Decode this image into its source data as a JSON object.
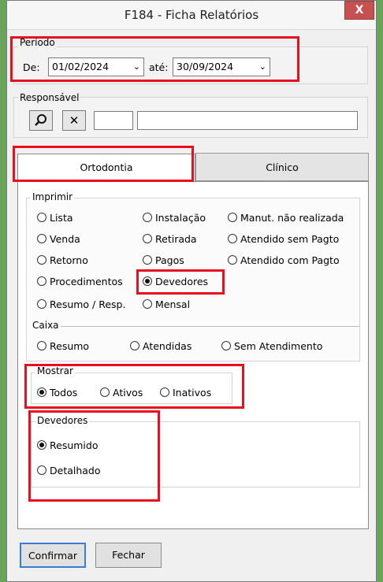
{
  "window": {
    "title": "F184 - Ficha Relatórios",
    "close_label": "X"
  },
  "periodo": {
    "label": "Período",
    "de_label": "De:",
    "de_value": "01/02/2024",
    "ate_label": "até:",
    "ate_value": "30/09/2024"
  },
  "responsavel": {
    "label": "Responsável",
    "search_icon": "search-icon",
    "clear_label": "✕",
    "code_value": "",
    "name_value": ""
  },
  "tabs": [
    {
      "label": "Ortodontia",
      "selected": true
    },
    {
      "label": "Clínico",
      "selected": false
    }
  ],
  "imprimir": {
    "label": "Imprimir",
    "options": [
      {
        "label": "Lista",
        "checked": false
      },
      {
        "label": "Venda",
        "checked": false
      },
      {
        "label": "Retorno",
        "checked": false
      },
      {
        "label": "Procedimentos",
        "checked": false
      },
      {
        "label": "Resumo / Resp.",
        "checked": false
      },
      {
        "label": "Instalação",
        "checked": false
      },
      {
        "label": "Retirada",
        "checked": false
      },
      {
        "label": "Pagos",
        "checked": false
      },
      {
        "label": "Devedores",
        "checked": true
      },
      {
        "label": "Mensal",
        "checked": false
      },
      {
        "label": "Manut. não realizada",
        "checked": false
      },
      {
        "label": "Atendido sem Pagto",
        "checked": false
      },
      {
        "label": "Atendido com Pagto",
        "checked": false
      }
    ]
  },
  "caixa": {
    "label": "Caixa",
    "options": [
      {
        "label": "Resumo",
        "checked": false
      },
      {
        "label": "Atendidas",
        "checked": false
      },
      {
        "label": "Sem Atendimento",
        "checked": false
      }
    ]
  },
  "mostrar": {
    "label": "Mostrar",
    "options": [
      {
        "label": "Todos",
        "checked": true
      },
      {
        "label": "Ativos",
        "checked": false
      },
      {
        "label": "Inativos",
        "checked": false
      }
    ]
  },
  "devedores": {
    "label": "Devedores",
    "options": [
      {
        "label": "Resumido",
        "checked": true
      },
      {
        "label": "Detalhado",
        "checked": false
      }
    ]
  },
  "buttons": {
    "confirmar": "Confirmar",
    "fechar": "Fechar"
  },
  "colors": {
    "highlight": "#e8101e",
    "background": "#f0f0f0",
    "close_button": "#c75050"
  }
}
